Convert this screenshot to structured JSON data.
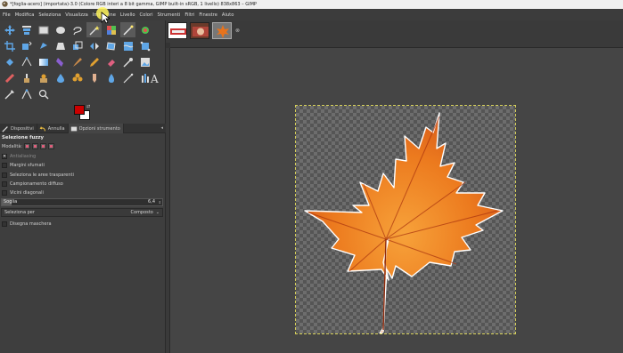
{
  "window": {
    "title": "*[foglia-acero] (importata)-3.0 (Colore RGB interi a 8 bit gamma, GIMP built-in sRGB, 1 livello) 838x863 – GIMP"
  },
  "menu": [
    "File",
    "Modifica",
    "Seleziona",
    "Visualizza",
    "Immagine",
    "Livello",
    "Colori",
    "Strumenti",
    "Filtri",
    "Finestre",
    "Aiuto"
  ],
  "colors": {
    "foreground": "#cc0000",
    "background": "#ffffff",
    "leaf": "#e8731c",
    "selection_outline": "#d8d25a"
  },
  "tabs": {
    "devices": "Dispositivi",
    "undo": "Annulla",
    "tool_options": "Opzioni strumento"
  },
  "tool_options": {
    "title": "Selezione fuzzy",
    "mode_label": "Modalità:",
    "antialiasing": {
      "label": "Antialiasing",
      "checked": true
    },
    "feather_edges": {
      "label": "Margini sfumati",
      "checked": false
    },
    "select_transparent": {
      "label": "Seleziona le aree trasparenti",
      "checked": false
    },
    "sample_merged": {
      "label": "Campionamento diffuso",
      "checked": false
    },
    "diagonal_neighbors": {
      "label": "Vicini diagonali",
      "checked": false
    },
    "threshold": {
      "label": "Soglia",
      "value": "6,4"
    },
    "select_by": {
      "label": "Seleziona per",
      "value": "Composto"
    },
    "draw_mask": {
      "label": "Disegna maschera",
      "checked": false
    }
  },
  "icons": {
    "title": "gimp-wilber-icon",
    "swap": "swap-colors-icon",
    "thumbnail_close": "close-icon"
  }
}
